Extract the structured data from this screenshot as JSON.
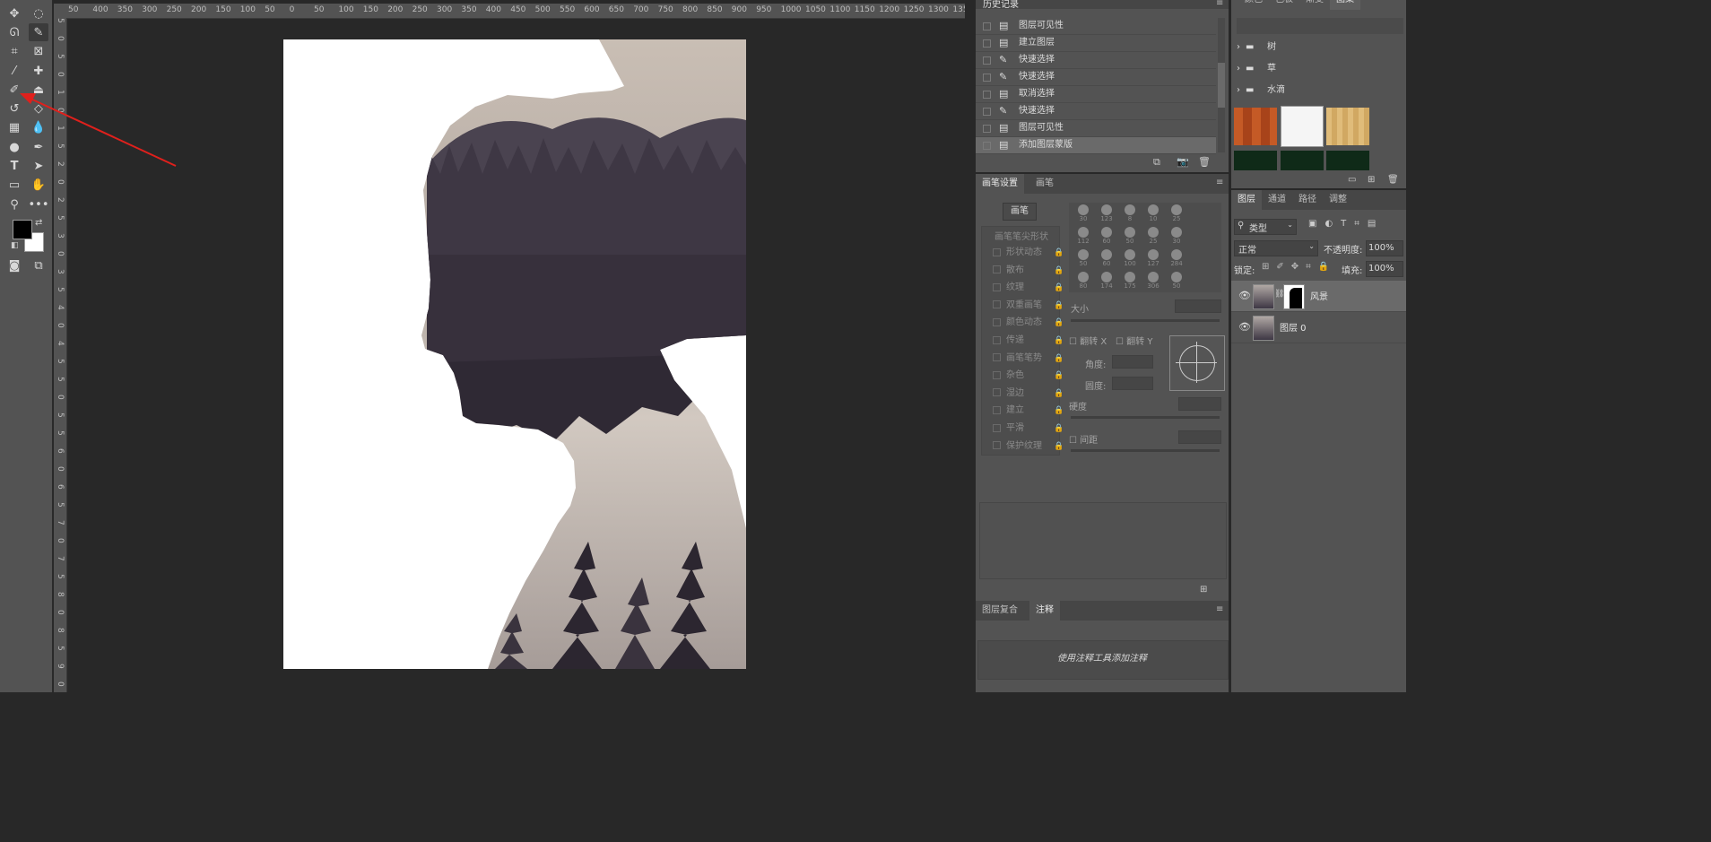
{
  "ruler_top": [
    "50",
    "400",
    "350",
    "300",
    "250",
    "200",
    "150",
    "100",
    "50",
    "0",
    "50",
    "100",
    "150",
    "200",
    "250",
    "300",
    "350",
    "400",
    "450",
    "500",
    "550",
    "600",
    "650",
    "700",
    "750",
    "800",
    "850",
    "900",
    "950",
    "1000",
    "1050",
    "1100",
    "1150",
    "1200",
    "1250",
    "1300",
    "1350"
  ],
  "ruler_left": [
    "5",
    "0",
    "5",
    "0",
    "1",
    "0",
    "1",
    "5",
    "2",
    "0",
    "2",
    "5",
    "3",
    "0",
    "3",
    "5",
    "4",
    "0",
    "4",
    "5",
    "5",
    "0",
    "5",
    "5",
    "6",
    "0",
    "6",
    "5",
    "7",
    "0",
    "7",
    "5",
    "8",
    "0",
    "8",
    "5",
    "9",
    "0"
  ],
  "history": {
    "title": "历史记录",
    "items": [
      {
        "label": "图层可见性",
        "icon": "doc-icon"
      },
      {
        "label": "建立图层",
        "icon": "doc-icon"
      },
      {
        "label": "快速选择",
        "icon": "quick-select-icon"
      },
      {
        "label": "快速选择",
        "icon": "quick-select-icon"
      },
      {
        "label": "取消选择",
        "icon": "doc-icon"
      },
      {
        "label": "快速选择",
        "icon": "quick-select-icon"
      },
      {
        "label": "图层可见性",
        "icon": "doc-icon"
      },
      {
        "label": "添加图层蒙版",
        "icon": "doc-icon",
        "selected": true
      }
    ]
  },
  "swatches_panel": {
    "tabs": [
      "颜色",
      "色板",
      "渐变",
      "图案"
    ],
    "active_tab": "图案",
    "folders": [
      "树",
      "草",
      "水滴"
    ]
  },
  "brush_settings": {
    "tabs": [
      "画笔设置",
      "画笔"
    ],
    "brush_button": "画笔",
    "tip_shape": "画笔笔尖形状",
    "options": [
      "形状动态",
      "散布",
      "纹理",
      "双重画笔",
      "颜色动态",
      "传递",
      "画笔笔势",
      "杂色",
      "湿边",
      "建立",
      "平滑",
      "保护纹理"
    ],
    "brush_sizes": [
      "30",
      "123",
      "8",
      "10",
      "25",
      "112",
      "60",
      "50",
      "25",
      "30",
      "50",
      "60",
      "100",
      "127",
      "284",
      "80",
      "174",
      "175",
      "306",
      "50"
    ],
    "size_label": "大小",
    "flip_x": "翻转 X",
    "flip_y": "翻转 Y",
    "angle_label": "角度:",
    "roundness_label": "圆度:",
    "hardness_label": "硬度",
    "spacing_label": "间距"
  },
  "layers_panel": {
    "tabs": [
      "图层",
      "通道",
      "路径",
      "调整"
    ],
    "active_tab": "图层",
    "filter_type": "类型",
    "blend_mode": "正常",
    "opacity_label": "不透明度:",
    "opacity_value": "100%",
    "lock_label": "锁定:",
    "fill_label": "填充:",
    "fill_value": "100%",
    "layers": [
      {
        "name": "风景",
        "selected": true,
        "has_mask": true
      },
      {
        "name": "图层 0",
        "selected": false,
        "has_mask": false
      }
    ]
  },
  "comps_panel": {
    "tabs": [
      "图层复合",
      "注释"
    ],
    "active_tab": "注释",
    "hint": "使用注释工具添加注释"
  },
  "colors": {
    "foreground": "#000000",
    "background": "#ffffff",
    "annotation_arrow": "#e0201c"
  }
}
